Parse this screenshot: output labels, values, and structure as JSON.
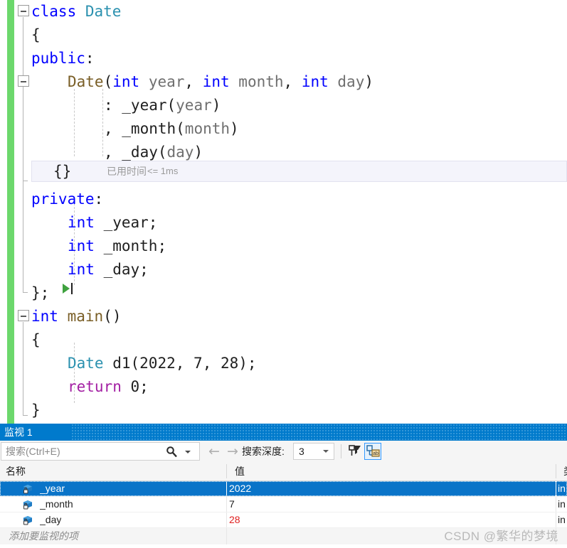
{
  "editor": {
    "lines": [
      {
        "indent": 0,
        "fold": true,
        "tokens": [
          {
            "t": "class ",
            "c": "kw"
          },
          {
            "t": "Date",
            "c": "type"
          }
        ]
      },
      {
        "indent": 0,
        "fold": false,
        "tokens": [
          {
            "t": "{",
            "c": "plain"
          }
        ]
      },
      {
        "indent": 0,
        "fold": false,
        "tokens": [
          {
            "t": "public",
            "c": "kw"
          },
          {
            "t": ":",
            "c": "plain"
          }
        ]
      },
      {
        "indent": 1,
        "fold": true,
        "tokens": [
          {
            "t": "Date",
            "c": "fn"
          },
          {
            "t": "(",
            "c": "plain"
          },
          {
            "t": "int",
            "c": "kw"
          },
          {
            "t": " ",
            "c": "plain"
          },
          {
            "t": "year",
            "c": "id"
          },
          {
            "t": ", ",
            "c": "plain"
          },
          {
            "t": "int",
            "c": "kw"
          },
          {
            "t": " ",
            "c": "plain"
          },
          {
            "t": "month",
            "c": "id"
          },
          {
            "t": ", ",
            "c": "plain"
          },
          {
            "t": "int",
            "c": "kw"
          },
          {
            "t": " ",
            "c": "plain"
          },
          {
            "t": "day",
            "c": "id"
          },
          {
            "t": ")",
            "c": "plain"
          }
        ]
      },
      {
        "indent": 2,
        "fold": false,
        "tokens": [
          {
            "t": ": _year(",
            "c": "plain"
          },
          {
            "t": "year",
            "c": "id"
          },
          {
            "t": ")",
            "c": "plain"
          }
        ]
      },
      {
        "indent": 2,
        "fold": false,
        "tokens": [
          {
            "t": ", _month(",
            "c": "plain"
          },
          {
            "t": "month",
            "c": "id"
          },
          {
            "t": ")",
            "c": "plain"
          }
        ]
      },
      {
        "indent": 2,
        "fold": false,
        "tokens": [
          {
            "t": ", _day(",
            "c": "plain"
          },
          {
            "t": "day",
            "c": "id"
          },
          {
            "t": ")",
            "c": "plain"
          }
        ]
      },
      {
        "indent": 0,
        "fold": false,
        "tokens": []
      },
      {
        "indent": 0,
        "fold": false,
        "tokens": [
          {
            "t": "private",
            "c": "kw"
          },
          {
            "t": ":",
            "c": "plain"
          }
        ]
      },
      {
        "indent": 1,
        "fold": false,
        "tokens": [
          {
            "t": "int",
            "c": "kw"
          },
          {
            "t": " _year;",
            "c": "plain"
          }
        ]
      },
      {
        "indent": 1,
        "fold": false,
        "tokens": [
          {
            "t": "int",
            "c": "kw"
          },
          {
            "t": " _month;",
            "c": "plain"
          }
        ]
      },
      {
        "indent": 1,
        "fold": false,
        "tokens": [
          {
            "t": "int",
            "c": "kw"
          },
          {
            "t": " _day;",
            "c": "plain"
          }
        ]
      },
      {
        "indent": 0,
        "fold": false,
        "tokens": [
          {
            "t": "};",
            "c": "plain"
          }
        ]
      },
      {
        "indent": 0,
        "fold": true,
        "tokens": [
          {
            "t": "int",
            "c": "kw"
          },
          {
            "t": " ",
            "c": "plain"
          },
          {
            "t": "main",
            "c": "fn"
          },
          {
            "t": "()",
            "c": "plain"
          }
        ]
      },
      {
        "indent": 0,
        "fold": false,
        "tokens": [
          {
            "t": "{",
            "c": "plain"
          }
        ]
      },
      {
        "indent": 1,
        "fold": false,
        "tokens": [
          {
            "t": "Date",
            "c": "type"
          },
          {
            "t": " d1(",
            "c": "plain"
          },
          {
            "t": "2022",
            "c": "num"
          },
          {
            "t": ", ",
            "c": "plain"
          },
          {
            "t": "7",
            "c": "num"
          },
          {
            "t": ", ",
            "c": "plain"
          },
          {
            "t": "28",
            "c": "num"
          },
          {
            "t": ");",
            "c": "plain"
          }
        ]
      },
      {
        "indent": 1,
        "fold": false,
        "tokens": [
          {
            "t": "return",
            "c": "ctl"
          },
          {
            "t": " ",
            "c": "plain"
          },
          {
            "t": "0",
            "c": "num"
          },
          {
            "t": ";",
            "c": "plain"
          }
        ]
      },
      {
        "indent": 0,
        "fold": false,
        "tokens": [
          {
            "t": "}",
            "c": "plain"
          }
        ]
      }
    ],
    "codelens": {
      "braces": "{}",
      "label": "已用时间",
      "value": "<= 1ms"
    },
    "run_arrow_icon": "run-to-here-icon",
    "change_bar_color": "#6cd86c"
  },
  "watch": {
    "tab_label": "监视 1",
    "tab_color": "#007acc",
    "search": {
      "placeholder": "搜索(Ctrl+E)",
      "value": "",
      "icon": "search-icon",
      "dropdown_icon": "chevron-down-icon"
    },
    "nav": {
      "back_icon": "arrow-left-icon",
      "forward_icon": "arrow-right-icon"
    },
    "depth": {
      "label": "搜索深度:",
      "value": "3",
      "caret_icon": "chevron-down-icon"
    },
    "toolbar_buttons": [
      {
        "name": "pin-filter-icon",
        "active": false
      },
      {
        "name": "show-raw-structure-icon",
        "active": true
      }
    ],
    "columns": [
      {
        "key": "name",
        "label": "名称"
      },
      {
        "key": "value",
        "label": "值"
      },
      {
        "key": "type",
        "label": "类"
      }
    ],
    "rows": [
      {
        "icon": "field-private-icon",
        "name": "_year",
        "value": "2022",
        "type": "in",
        "selected": true,
        "value_changed": false
      },
      {
        "icon": "field-private-icon",
        "name": "_month",
        "value": "7",
        "type": "in",
        "selected": false,
        "value_changed": false
      },
      {
        "icon": "field-private-icon",
        "name": "_day",
        "value": "28",
        "type": "in",
        "selected": false,
        "value_changed": true
      }
    ],
    "add_row_placeholder": "添加要监视的项",
    "selected_row_color": "#0a74c8",
    "changed_value_color": "#e02020"
  },
  "watermark": "CSDN @繁华的梦境"
}
